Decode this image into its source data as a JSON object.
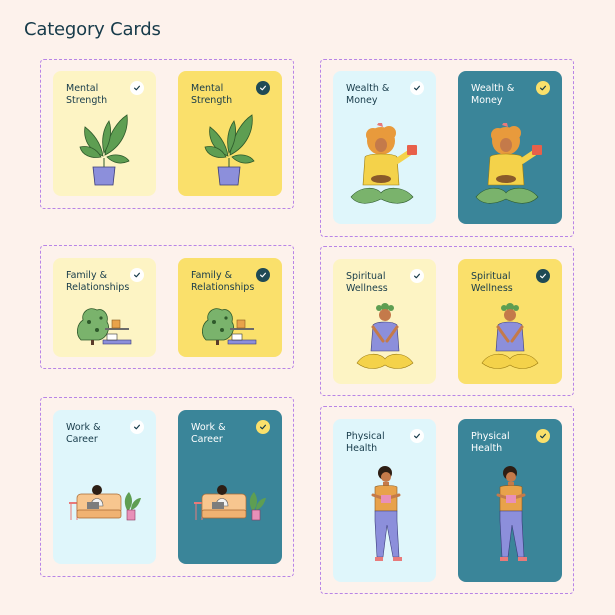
{
  "page": {
    "title": "Category Cards"
  },
  "colors": {
    "background": "#fdf2ec",
    "group_border": "#b884e6",
    "light_yellow": "#fdf4c4",
    "yellow": "#fae06b",
    "light_blue": "#dff6fb",
    "teal": "#3a8599",
    "dark_text": "#173b4a",
    "light_text": "#ffffff"
  },
  "cards": {
    "mental_unselected": {
      "label": "Mental\nStrength",
      "state": "unselected",
      "icon": "plant-icon"
    },
    "mental_selected": {
      "label": "Mental\nStrength",
      "state": "selected",
      "icon": "plant-icon"
    },
    "family_unselected": {
      "label": "Family &\nRelationships",
      "state": "unselected",
      "icon": "tree-table-icon"
    },
    "family_selected": {
      "label": "Family &\nRelationships",
      "state": "selected",
      "icon": "tree-table-icon"
    },
    "work_unselected": {
      "label": "Work &\nCareer",
      "state": "unselected",
      "icon": "sofa-laptop-icon"
    },
    "work_selected": {
      "label": "Work &\nCareer",
      "state": "selected",
      "icon": "sofa-laptop-icon"
    },
    "wealth_unselected": {
      "label": "Wealth &\nMoney",
      "state": "unselected",
      "icon": "woman-coffee-icon"
    },
    "wealth_selected": {
      "label": "Wealth &\nMoney",
      "state": "selected",
      "icon": "woman-coffee-icon"
    },
    "spiritual_unselected": {
      "label": "Spiritual\nWellness",
      "state": "unselected",
      "icon": "meditation-icon"
    },
    "spiritual_selected": {
      "label": "Spiritual\nWellness",
      "state": "selected",
      "icon": "meditation-icon"
    },
    "physical_unselected": {
      "label": "Physical\nHealth",
      "state": "unselected",
      "icon": "exercise-person-icon"
    },
    "physical_selected": {
      "label": "Physical\nHealth",
      "state": "selected",
      "icon": "exercise-person-icon"
    }
  }
}
